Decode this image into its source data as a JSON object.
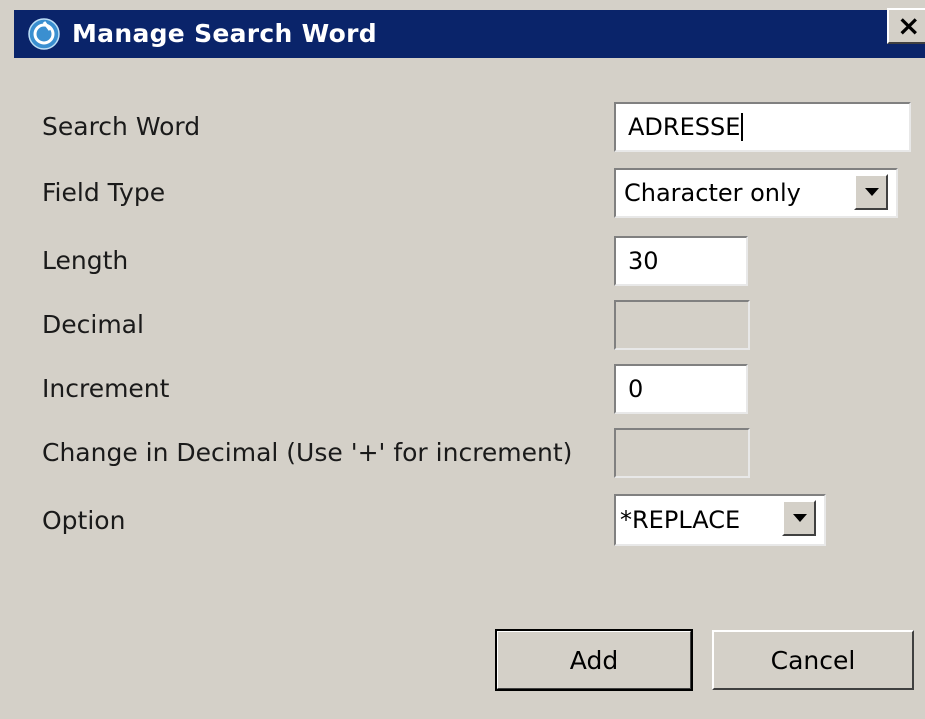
{
  "window": {
    "title": "Manage Search Word",
    "close_glyph": "×",
    "icon": "app-logo-icon",
    "colors": {
      "titlebar": "#0a246a",
      "dialog_bg": "#d4d0c8",
      "icon": "#3a8fd0"
    }
  },
  "form": {
    "search_word": {
      "label": "Search Word",
      "value": "ADRESSE"
    },
    "field_type": {
      "label": "Field Type",
      "value": "Character only"
    },
    "length": {
      "label": "Length",
      "value": "30"
    },
    "decimal": {
      "label": "Decimal",
      "value": ""
    },
    "increment": {
      "label": "Increment",
      "value": "0"
    },
    "change_in_decimal": {
      "label": "Change in Decimal (Use '+' for increment)",
      "value": ""
    },
    "option": {
      "label": "Option",
      "value": "*REPLACE"
    }
  },
  "buttons": {
    "add": "Add",
    "cancel": "Cancel"
  }
}
